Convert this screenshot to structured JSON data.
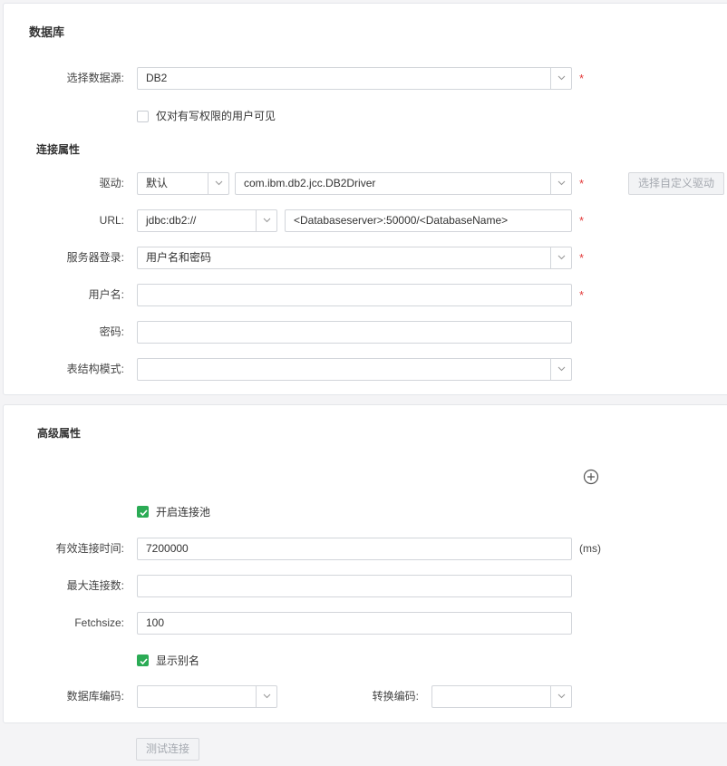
{
  "database_section": {
    "title": "数据库",
    "datasource": {
      "label": "选择数据源:",
      "value": "DB2"
    },
    "write_permission_checkbox": {
      "label": "仅对有写权限的用户可见",
      "checked": false
    },
    "connection_properties": {
      "title": "连接属性",
      "driver": {
        "label": "驱动:",
        "type_value": "默认",
        "class_value": "com.ibm.db2.jcc.DB2Driver",
        "custom_driver_button": "选择自定义驱动"
      },
      "url": {
        "label": "URL:",
        "prefix_value": "jdbc:db2://",
        "value": "<Databaseserver>:50000/<DatabaseName>"
      },
      "server_login": {
        "label": "服务器登录:",
        "value": "用户名和密码"
      },
      "username": {
        "label": "用户名:",
        "value": ""
      },
      "password": {
        "label": "密码:",
        "value": ""
      },
      "schema": {
        "label": "表结构模式:",
        "value": ""
      }
    },
    "required_mark": "*"
  },
  "advanced_section": {
    "title": "高级属性",
    "add_icon": "plus-circle-icon",
    "connection_pool_checkbox": {
      "label": "开启连接池",
      "checked": true
    },
    "valid_connection_time": {
      "label": "有效连接时间:",
      "value": "7200000",
      "unit": "(ms)"
    },
    "max_connections": {
      "label": "最大连接数:",
      "value": ""
    },
    "fetchsize": {
      "label": "Fetchsize:",
      "value": "100"
    },
    "show_alias_checkbox": {
      "label": "显示别名",
      "checked": true
    },
    "database_encoding": {
      "label": "数据库编码:",
      "value": ""
    },
    "convert_encoding": {
      "label": "转换编码:",
      "value": ""
    }
  },
  "test_connection_button": "测试连接",
  "colors": {
    "accent_green": "#2bab55",
    "required_red": "#e33b3b",
    "border": "#d2d5da",
    "page_bg": "#f4f4f6"
  }
}
